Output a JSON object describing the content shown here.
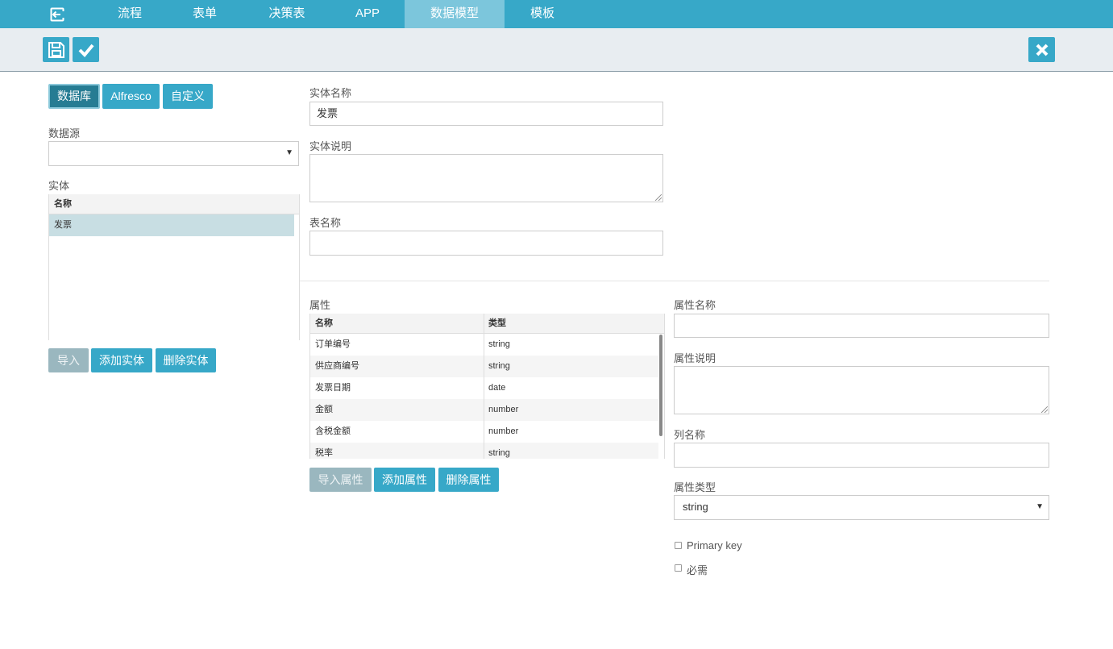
{
  "nav": {
    "back_icon": "exit-icon",
    "items": [
      {
        "label": "流程"
      },
      {
        "label": "表单"
      },
      {
        "label": "决策表"
      },
      {
        "label": "APP"
      },
      {
        "label": "数据模型",
        "active": true
      },
      {
        "label": "模板"
      }
    ]
  },
  "toolbar": {
    "save_icon": "save-icon",
    "confirm_icon": "check-icon",
    "close_icon": "close-icon"
  },
  "source_tabs": [
    "数据库",
    "Alfresco",
    "自定义"
  ],
  "datasource": {
    "label": "数据源",
    "value": ""
  },
  "entities": {
    "label": "实体",
    "column": "名称",
    "rows": [
      "发票"
    ],
    "selected_index": 0,
    "buttons": {
      "import": "导入",
      "add": "添加实体",
      "delete": "删除实体"
    }
  },
  "entity_form": {
    "name_label": "实体名称",
    "name_value": "发票",
    "description_label": "实体说明",
    "description_value": "",
    "table_label": "表名称",
    "table_value": ""
  },
  "attributes": {
    "label": "属性",
    "columns": [
      "名称",
      "类型"
    ],
    "rows": [
      {
        "name": "订单编号",
        "type": "string"
      },
      {
        "name": "供应商编号",
        "type": "string"
      },
      {
        "name": "发票日期",
        "type": "date"
      },
      {
        "name": "金额",
        "type": "number"
      },
      {
        "name": "含税金额",
        "type": "number"
      },
      {
        "name": "税率",
        "type": "string"
      }
    ],
    "buttons": {
      "import": "导入属性",
      "add": "添加属性",
      "delete": "删除属性"
    }
  },
  "attribute_form": {
    "name_label": "属性名称",
    "name_value": "",
    "description_label": "属性说明",
    "description_value": "",
    "column_label": "列名称",
    "column_value": "",
    "type_label": "属性类型",
    "type_value": "string",
    "primary_key_label": "Primary key",
    "primary_key_checked": false,
    "required_label": "必需",
    "required_checked": false
  },
  "colors": {
    "accent": "#37a8c8",
    "nav_active": "#7cc6dc",
    "toolbar_bg": "#e8edf1",
    "selected_row": "#c8dee3"
  }
}
